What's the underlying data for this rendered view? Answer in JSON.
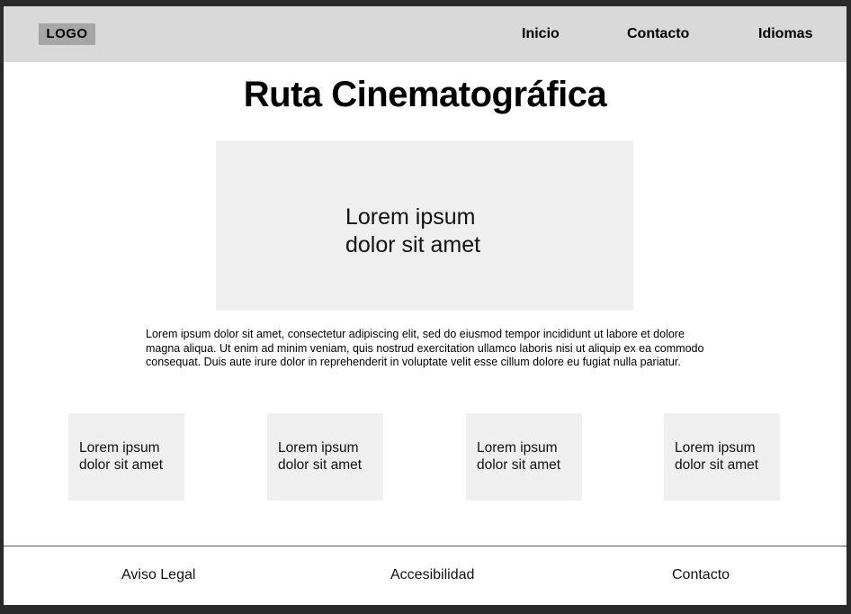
{
  "header": {
    "logo": "LOGO",
    "nav": [
      {
        "label": "Inicio"
      },
      {
        "label": "Contacto"
      },
      {
        "label": "Idiomas"
      }
    ]
  },
  "main": {
    "title": "Ruta Cinematográfica",
    "hero": {
      "line1": "Lorem ipsum",
      "line2": "dolor sit amet"
    },
    "paragraph": "Lorem ipsum dolor sit amet, consectetur adipiscing elit, sed do eiusmod tempor incididunt ut labore et dolore magna aliqua. Ut enim ad minim veniam, quis nostrud exercitation ullamco laboris nisi ut aliquip ex ea commodo consequat. Duis aute irure dolor in reprehenderit in voluptate velit esse cillum dolore eu fugiat nulla pariatur.",
    "cards": [
      {
        "line1": "Lorem ipsum",
        "line2": "dolor sit amet"
      },
      {
        "line1": "Lorem ipsum",
        "line2": "dolor sit amet"
      },
      {
        "line1": "Lorem ipsum",
        "line2": "dolor sit amet"
      },
      {
        "line1": "Lorem ipsum",
        "line2": "dolor sit amet"
      }
    ]
  },
  "footer": {
    "links": [
      {
        "label": "Aviso Legal"
      },
      {
        "label": "Accesibilidad"
      },
      {
        "label": "Contacto"
      }
    ]
  },
  "colors": {
    "background_outer": "#2a2a2a",
    "header_bg": "#d9d9d9",
    "logo_bg": "#a6a6a6",
    "placeholder_bg": "#efefef",
    "text": "#000000"
  }
}
